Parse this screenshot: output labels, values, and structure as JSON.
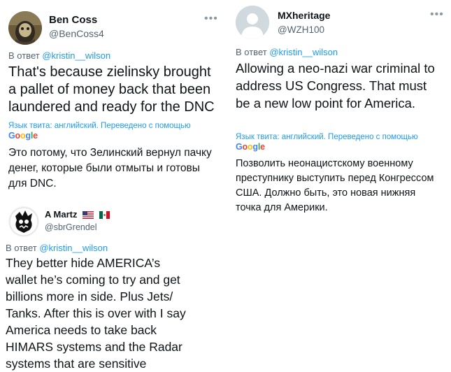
{
  "tweets": [
    {
      "author_name": "Ben Coss",
      "author_handle": "@BenCoss4",
      "reply_prefix": "В ответ",
      "reply_to": "@kristin__wilson",
      "text": "That's because zielinsky brought a pallet of money back that been laundered and ready for the DNC",
      "translation_note": "Язык твита: английский. Переведено с помощью",
      "translation_provider": "Google",
      "translation": "Это потому, что Зелинский вернул пачку денег, которые были отмыты и готовы для DNC."
    },
    {
      "author_name": "A Martz",
      "author_flags": [
        "us-flag-icon",
        "mexico-flag-icon"
      ],
      "author_handle": "@sbrGrendel",
      "reply_prefix": "В ответ",
      "reply_to": "@kristin__wilson",
      "text": "They better hide AMERICA’s wallet he’s coming to try and get billions more in side. Plus Jets/ Tanks. After this is over with I say America needs to take back HIMARS systems and the Radar systems that are sensitive"
    },
    {
      "author_name": "MXheritage",
      "author_handle": "@WZH100",
      "reply_prefix": "В ответ",
      "reply_to": "@kristin__wilson",
      "text": "Allowing a neo-nazi war criminal to address US Congress. That must be a new low point for America.",
      "translation_note": "Язык твита: английский. Переведено с помощью",
      "translation_provider": "Google",
      "translation": "Позволить неонацистскому военному преступнику выступить перед Конгрессом США. Должно быть, это новая нижняя точка для Америки."
    }
  ],
  "icons": {
    "more": "more-options-icon",
    "default_avatar": "default-avatar-icon"
  },
  "colors": {
    "link": "#1d9bf0",
    "secondary_text": "#536471",
    "google_blue": "#4285f4",
    "google_red": "#ea4335",
    "google_yellow": "#fbbc05",
    "google_green": "#34a853"
  }
}
